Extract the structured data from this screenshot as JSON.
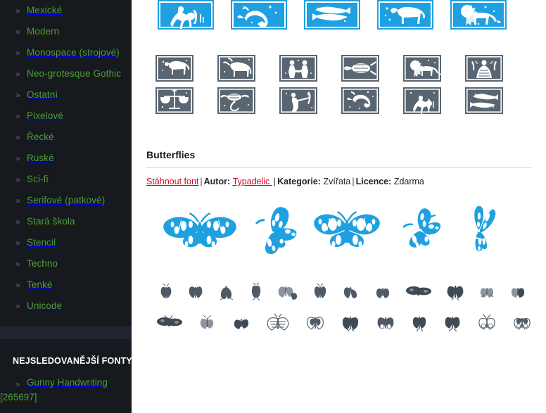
{
  "page": {
    "background": "#ffffff",
    "sidebar_background": "#16191d",
    "link_green": "#4e9c3f",
    "link_red": "#d0021b",
    "preview_blue": "#1fa0e0",
    "preview_grey": "#596571"
  },
  "sidebar": {
    "categories": [
      {
        "chevron": "»",
        "label": "Mexické"
      },
      {
        "chevron": "»",
        "label": "Modern"
      },
      {
        "chevron": "»",
        "label": "Monospace (strojové)"
      },
      {
        "chevron": "»",
        "label": "Neo-grotesque Gothic"
      },
      {
        "chevron": "»",
        "label": "Ostatní"
      },
      {
        "chevron": "»",
        "label": "Pixelové"
      },
      {
        "chevron": "»",
        "label": "Řecké"
      },
      {
        "chevron": "»",
        "label": "Ruské"
      },
      {
        "chevron": "»",
        "label": "Sci-fi"
      },
      {
        "chevron": "»",
        "label": "Serifové (patkové)"
      },
      {
        "chevron": "»",
        "label": "Stará škola"
      },
      {
        "chevron": "»",
        "label": "Stencil"
      },
      {
        "chevron": "»",
        "label": "Techno"
      },
      {
        "chevron": "»",
        "label": "Tenké"
      },
      {
        "chevron": "»",
        "label": "Unicode"
      }
    ],
    "most_watched": {
      "heading": "NEJSLEDOVANĚJŠÍ FONTY",
      "items": [
        {
          "chevron": "»",
          "label": "Gunny Handwriting [265697]"
        }
      ]
    }
  },
  "main": {
    "top_preview": {
      "name": "zodiac-font-preview",
      "large_row_count": 5,
      "small_row_count": 12,
      "large_color": "#1fa0e0",
      "small_color": "#596571",
      "large_glyph_names": [
        "aquarius",
        "capricorn",
        "pisces",
        "aries",
        "leo"
      ],
      "small_glyph_names": [
        "aries",
        "taurus",
        "gemini",
        "cancer",
        "leo",
        "virgo",
        "libra",
        "scorpio",
        "sagittarius",
        "capricorn",
        "aquarius",
        "pisces"
      ]
    },
    "font_entry": {
      "title": "Butterflies",
      "download_label": "Stáhnout font",
      "sep1": "|",
      "author_label": "Autor:",
      "author_name": "Typadelic ",
      "sep2": "|",
      "category_label": "Kategorie:",
      "category_value": "Zvířata",
      "sep3": "|",
      "license_label": "Licence:",
      "license_value": "Zdarma",
      "preview": {
        "name": "butterflies-font-preview",
        "large_row_count": 5,
        "small_row1_count": 12,
        "small_row2_count": 11,
        "large_color": "#1fa0e0",
        "small_color": "#596571"
      }
    }
  }
}
